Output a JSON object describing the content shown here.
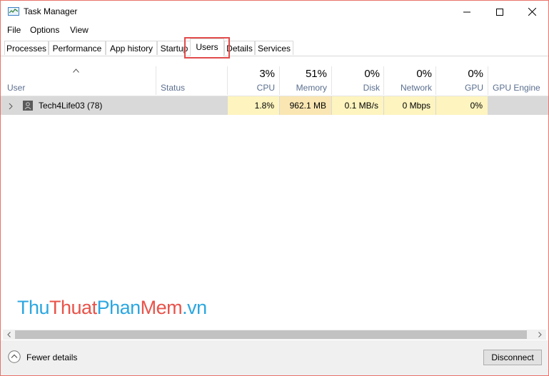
{
  "window": {
    "title": "Task Manager"
  },
  "menu": [
    "File",
    "Options",
    "View"
  ],
  "tabs": [
    "Processes",
    "Performance",
    "App history",
    "Startup",
    "Users",
    "Details",
    "Services"
  ],
  "active_tab": "Users",
  "columns": {
    "user": "User",
    "status": "Status",
    "cpu": {
      "pct": "3%",
      "name": "CPU"
    },
    "memory": {
      "pct": "51%",
      "name": "Memory"
    },
    "disk": {
      "pct": "0%",
      "name": "Disk"
    },
    "network": {
      "pct": "0%",
      "name": "Network"
    },
    "gpu": {
      "pct": "0%",
      "name": "GPU"
    },
    "gpu_engine": "GPU Engine"
  },
  "rows": [
    {
      "user": "Tech4Life03 (78)",
      "status": "",
      "cpu": "1.8%",
      "memory": "962.1 MB",
      "disk": "0.1 MB/s",
      "network": "0 Mbps",
      "gpu": "0%",
      "gpu_engine": ""
    }
  ],
  "watermark": {
    "part1": "Thu",
    "part2": "Thuat",
    "part3": "Phan",
    "part4": "Mem",
    "part5": ".vn"
  },
  "footer": {
    "fewer_details": "Fewer details",
    "disconnect": "Disconnect"
  },
  "colors": {
    "heat_cpu": "#fdf4bf",
    "heat_memory": "#f9e6b2",
    "heat_light": "#fdf4bf",
    "highlight_border": "#e24b4b",
    "window_border": "#e8736b"
  }
}
